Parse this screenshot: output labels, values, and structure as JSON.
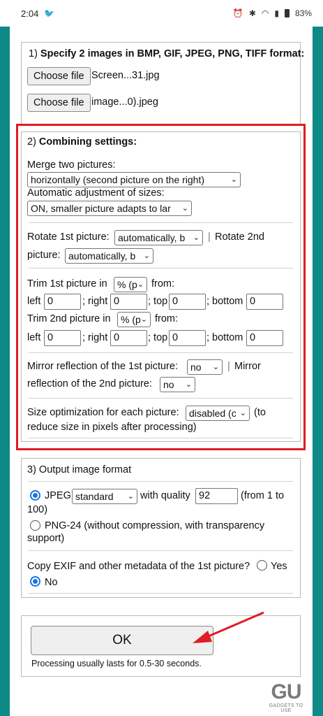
{
  "status_bar": {
    "time": "2:04",
    "right_icons": [
      "alarm-icon",
      "bluetooth-icon",
      "wifi-icon",
      "signal-icon",
      "battery-icon"
    ],
    "battery": "83%"
  },
  "section1": {
    "heading_prefix": "1) ",
    "heading": "Specify 2 images in BMP, GIF, JPEG, PNG, TIFF format:",
    "file1_button": "Choose file",
    "file1_name": "Screen...31.jpg",
    "file2_button": "Choose file",
    "file2_name": "image...0).jpeg"
  },
  "section2": {
    "heading_prefix": "2) ",
    "heading": "Combining settings:",
    "merge_label": "Merge two pictures:",
    "merge_value": "horizontally (second picture on the right)",
    "auto_adjust_label": "Automatic adjustment of sizes:",
    "auto_adjust_value": "ON, smaller picture adapts to lar",
    "rotate1_label": "Rotate 1st picture:",
    "rotate1_value": "automatically, b",
    "separator": "|",
    "rotate2_label_a": "Rotate 2nd",
    "rotate2_label_b": "picture:",
    "rotate2_value": "automatically, b",
    "trim1_label": "Trim 1st picture in",
    "trim1_unit": "% (p",
    "trim_from": "from:",
    "left": "left",
    "right": "; right",
    "top": "; top",
    "bottom": "; bottom",
    "trim1_values": {
      "left": "0",
      "right": "0",
      "top": "0",
      "bottom": "0"
    },
    "trim2_label": "Trim 2nd picture in",
    "trim2_unit": "% (p",
    "trim2_values": {
      "left": "0",
      "right": "0",
      "top": "0",
      "bottom": "0"
    },
    "mirror1_label": "Mirror reflection of the 1st picture:",
    "mirror1_value": "no",
    "mirror2_label_a": "Mirror",
    "mirror2_label_b": "reflection of the 2nd picture:",
    "mirror2_value": "no",
    "sizeopt_label": "Size optimization for each picture:",
    "sizeopt_value": "disabled (c",
    "sizeopt_note_a": "(to",
    "sizeopt_note_b": "reduce size in pixels after processing)"
  },
  "section3": {
    "heading": "3) Output image format",
    "jpeg_label": "JPEG",
    "jpeg_mode": "standard",
    "quality_label": "with quality",
    "quality_value": "92",
    "quality_range_a": "(from 1 to",
    "quality_range_b": "100)",
    "png_label_a": "PNG-24 (without compression, with transparency",
    "png_label_b": "support)",
    "exif_label": "Copy EXIF and other metadata of the 1st picture?",
    "exif_yes": "Yes",
    "exif_no": "No"
  },
  "submit": {
    "ok_label": "OK",
    "note": "Processing usually lasts for 0.5-30 seconds."
  },
  "watermark": {
    "logo": "GU",
    "text": "GADGETS TO USE"
  },
  "colors": {
    "background": "#0d8a86",
    "highlight_frame": "#e01c24",
    "annotation_arrow": "#e01c24",
    "radio_selected": "#1a73e8"
  }
}
